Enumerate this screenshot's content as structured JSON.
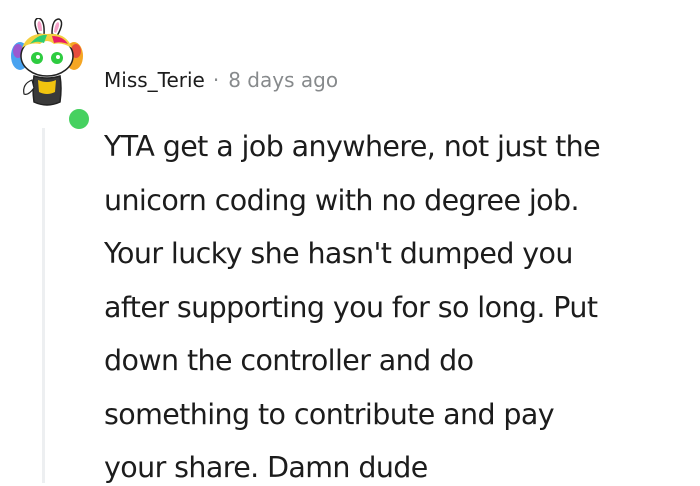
{
  "comment": {
    "author": "Miss_Terie",
    "separator": "·",
    "timestamp": "8 days ago",
    "avatar_icon": "snoo-avatar-icon",
    "online_status_color": "#46d160",
    "body_lines": [
      "YTA get a job anywhere, not just the",
      "unicorn coding with no degree job.",
      "Your lucky she hasn't dumped you",
      "after supporting you for so long. Put",
      "down the controller and do",
      "something to contribute and pay",
      "your share. Damn dude"
    ]
  }
}
